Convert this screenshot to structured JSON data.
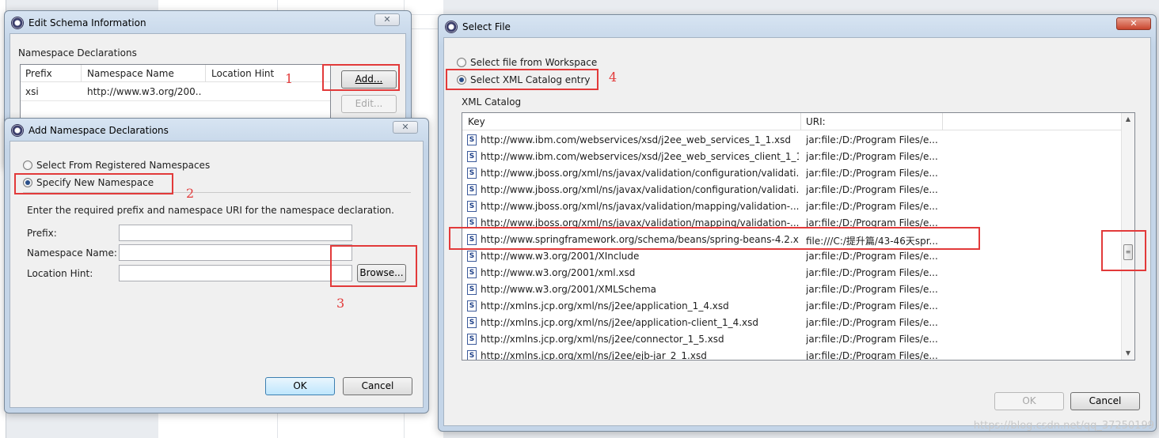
{
  "edit_schema": {
    "title": "Edit Schema Information",
    "group_label": "Namespace Declarations",
    "columns": [
      "Prefix",
      "Namespace Name",
      "Location Hint"
    ],
    "rows": [
      {
        "prefix": "xsi",
        "namespace": "http://www.w3.org/200...",
        "hint": ""
      }
    ],
    "add_label": "Add...",
    "edit_label": "Edit...",
    "close_glyph": "✕"
  },
  "add_ns": {
    "title": "Add Namespace Declarations",
    "radio_registered": "Select From Registered Namespaces",
    "radio_new": "Specify New Namespace",
    "instruction": "Enter the required prefix and namespace URI for the namespace declaration.",
    "prefix_label": "Prefix:",
    "prefix_value": "",
    "namespace_label": "Namespace Name:",
    "namespace_value": "",
    "hint_label": "Location Hint:",
    "hint_value": "",
    "browse_label": "Browse...",
    "ok_label": "OK",
    "cancel_label": "Cancel",
    "close_glyph": "✕"
  },
  "select_file": {
    "title": "Select File",
    "radio_workspace": "Select file from Workspace",
    "radio_catalog": "Select XML Catalog entry",
    "catalog_label": "XML Catalog",
    "columns": [
      "Key",
      "URI:"
    ],
    "rows": [
      {
        "key": "http://www.ibm.com/webservices/xsd/j2ee_web_services_1_1.xsd",
        "uri": "jar:file:/D:/Program Files/e..."
      },
      {
        "key": "http://www.ibm.com/webservices/xsd/j2ee_web_services_client_1_1...",
        "uri": "jar:file:/D:/Program Files/e..."
      },
      {
        "key": "http://www.jboss.org/xml/ns/javax/validation/configuration/validati...",
        "uri": "jar:file:/D:/Program Files/e..."
      },
      {
        "key": "http://www.jboss.org/xml/ns/javax/validation/configuration/validati...",
        "uri": "jar:file:/D:/Program Files/e..."
      },
      {
        "key": "http://www.jboss.org/xml/ns/javax/validation/mapping/validation-...",
        "uri": "jar:file:/D:/Program Files/e..."
      },
      {
        "key": "http://www.jboss.org/xml/ns/javax/validation/mapping/validation-...",
        "uri": "jar:file:/D:/Program Files/e..."
      },
      {
        "key": "http://www.springframework.org/schema/beans/spring-beans-4.2.x...",
        "uri": "file:///C:/提升篇/43-46天spr..."
      },
      {
        "key": "http://www.w3.org/2001/XInclude",
        "uri": "jar:file:/D:/Program Files/e..."
      },
      {
        "key": "http://www.w3.org/2001/xml.xsd",
        "uri": "jar:file:/D:/Program Files/e..."
      },
      {
        "key": "http://www.w3.org/2001/XMLSchema",
        "uri": "jar:file:/D:/Program Files/e..."
      },
      {
        "key": "http://xmlns.jcp.org/xml/ns/j2ee/application_1_4.xsd",
        "uri": "jar:file:/D:/Program Files/e..."
      },
      {
        "key": "http://xmlns.jcp.org/xml/ns/j2ee/application-client_1_4.xsd",
        "uri": "jar:file:/D:/Program Files/e..."
      },
      {
        "key": "http://xmlns.jcp.org/xml/ns/j2ee/connector_1_5.xsd",
        "uri": "jar:file:/D:/Program Files/e..."
      },
      {
        "key": "http://xmlns.jcp.org/xml/ns/j2ee/ejb-jar_2_1.xsd",
        "uri": "jar:file:/D:/Program Files/e..."
      }
    ],
    "ok_label": "OK",
    "cancel_label": "Cancel",
    "close_glyph": "✕"
  },
  "annotations": [
    "1",
    "2",
    "3",
    "4"
  ],
  "watermark": "https://blog.csdn.net/qq_37250199",
  "colors": {
    "annotation": "#e23a3a",
    "titlebar": "#c4d5e8"
  }
}
